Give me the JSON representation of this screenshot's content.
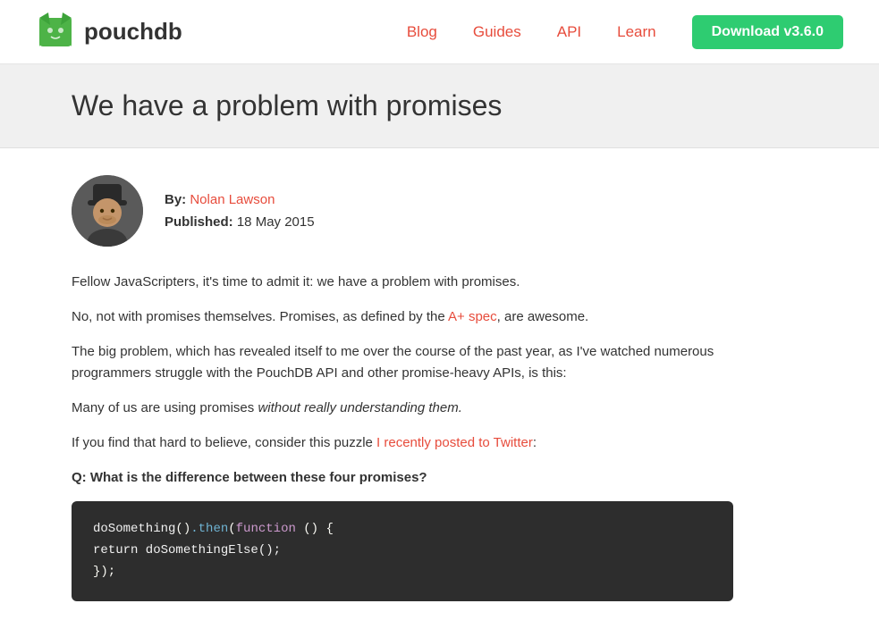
{
  "header": {
    "logo_text": "pouchdb",
    "nav": {
      "blog": "Blog",
      "guides": "Guides",
      "api": "API",
      "learn": "Learn",
      "download": "Download v3.6.0"
    }
  },
  "page": {
    "title": "We have a problem with promises"
  },
  "author": {
    "label_by": "By:",
    "name": "Nolan Lawson",
    "label_published": "Published:",
    "date": "18 May 2015"
  },
  "article": {
    "para1": "Fellow JavaScripters, it's time to admit it: we have a problem with promises.",
    "para2_start": "No, not with promises themselves. Promises, as defined by the ",
    "para2_link": "A+ spec",
    "para2_end": ", are awesome.",
    "para3": "The big problem, which has revealed itself to me over the course of the past year, as I've watched numerous programmers struggle with the PouchDB API and other promise-heavy APIs, is this:",
    "para4_start": "Many of us are using promises ",
    "para4_em": "without really understanding them.",
    "para5_start": "If you find that hard to believe, consider this puzzle ",
    "para5_link": "I recently posted to Twitter",
    "para5_end": ":",
    "para6": "Q: What is the difference between these four promises?",
    "code": {
      "line1_fn": "doSomething",
      "line1_method": ".then",
      "line1_keyword": "function",
      "line1_rest": " () {",
      "line2": "  return doSomethingElse();",
      "line3": "});"
    }
  }
}
